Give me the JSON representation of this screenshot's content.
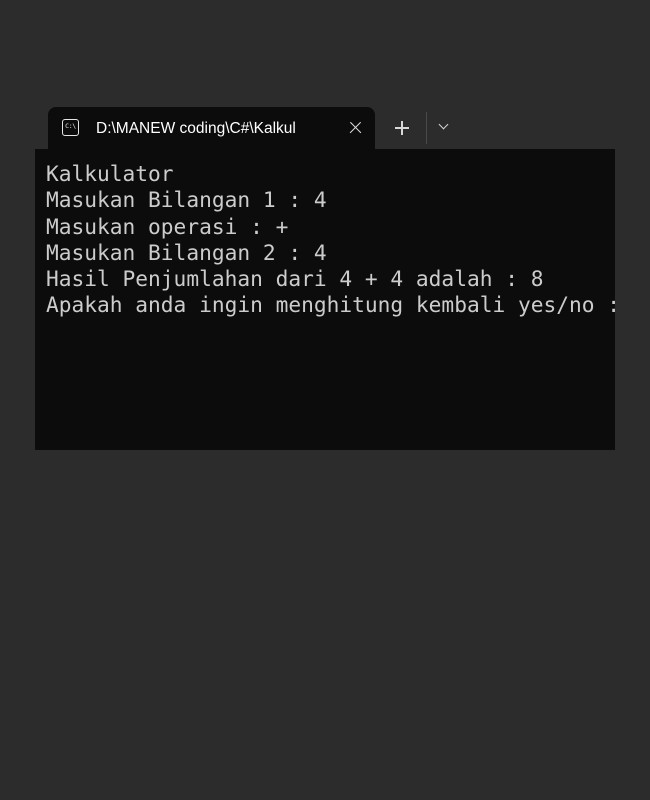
{
  "tab": {
    "icon": "terminal-icon",
    "icon_text": "C:\\",
    "title": "D:\\MANEW coding\\C#\\Kalkul",
    "close_icon": "close-icon"
  },
  "toolbar": {
    "new_tab_icon": "plus-icon",
    "dropdown_icon": "chevron-down-icon"
  },
  "console": {
    "lines": [
      "Kalkulator",
      "Masukan Bilangan 1 : 4",
      "Masukan operasi : +",
      "Masukan Bilangan 2 : 4",
      "Hasil Penjumlahan dari 4 + 4 adalah : 8",
      "Apakah anda ingin menghitung kembali yes/no : "
    ]
  },
  "colors": {
    "page_background": "#2c2c2c",
    "console_background": "#0c0c0c",
    "console_text": "#cccccc",
    "tab_text": "#ffffff"
  }
}
